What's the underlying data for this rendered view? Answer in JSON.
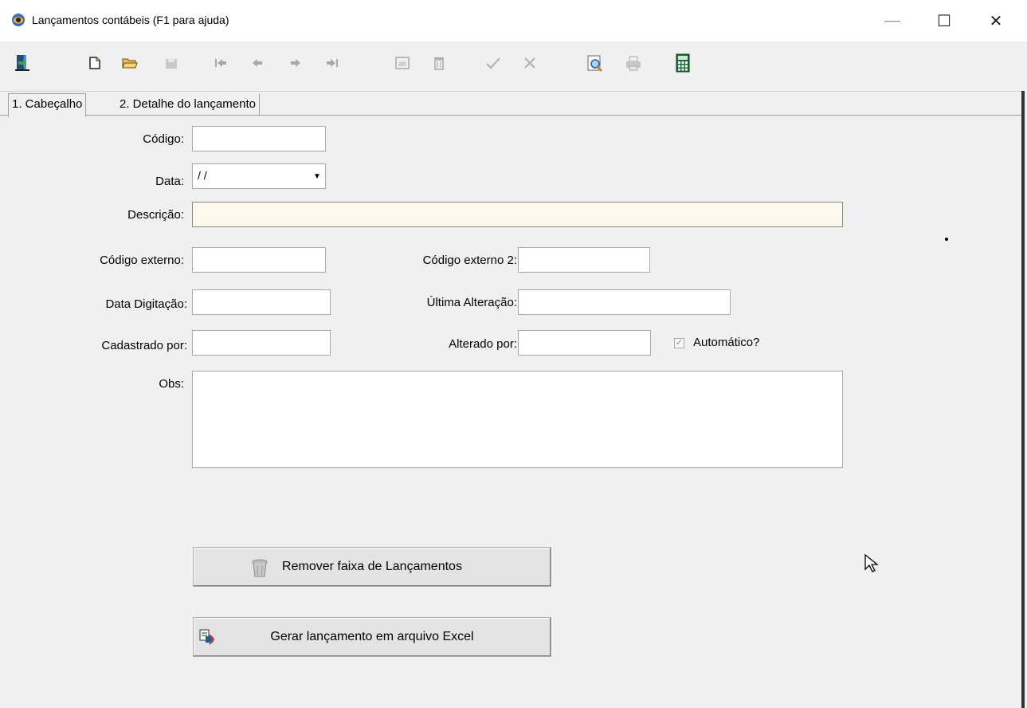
{
  "window": {
    "title": "Lançamentos contábeis (F1 para ajuda)",
    "minimize": "—",
    "maximize": "☐",
    "close": "✕"
  },
  "toolbar": {
    "icons": [
      "exit-icon",
      "new-icon",
      "open-icon",
      "save-icon",
      "first-icon",
      "prev-icon",
      "next-icon",
      "last-icon",
      "edit-icon",
      "delete-icon",
      "confirm-icon",
      "cancel-icon",
      "search-icon",
      "print-icon",
      "calculator-icon"
    ]
  },
  "tabs": [
    {
      "label": "1. Cabeçalho"
    },
    {
      "label": "2. Detalhe do lançamento"
    }
  ],
  "form": {
    "codigo_label": "Código:",
    "codigo_value": "",
    "data_label": "Data:",
    "data_value": " / /",
    "descricao_label": "Descrição:",
    "descricao_value": "",
    "codigo_externo_label": "Código externo:",
    "codigo_externo_value": "",
    "codigo_externo2_label": "Código externo 2:",
    "codigo_externo2_value": "",
    "data_digitacao_label": "Data Digitação:",
    "data_digitacao_value": "",
    "ultima_alteracao_label": "Última Alteração:",
    "ultima_alteracao_value": "",
    "cadastrado_por_label": "Cadastrado por:",
    "cadastrado_por_value": "",
    "alterado_por_label": "Alterado por:",
    "alterado_por_value": "",
    "automatico_label": "Automático?",
    "automatico_checked": true,
    "obs_label": "Obs:",
    "obs_value": ""
  },
  "buttons": {
    "remover_label": "Remover faixa de Lançamentos",
    "gerar_label": "Gerar lançamento em arquivo Excel"
  },
  "colors": {
    "descricao_bg": "#fdf8ec",
    "calculator_green": "#1a6e3a"
  }
}
